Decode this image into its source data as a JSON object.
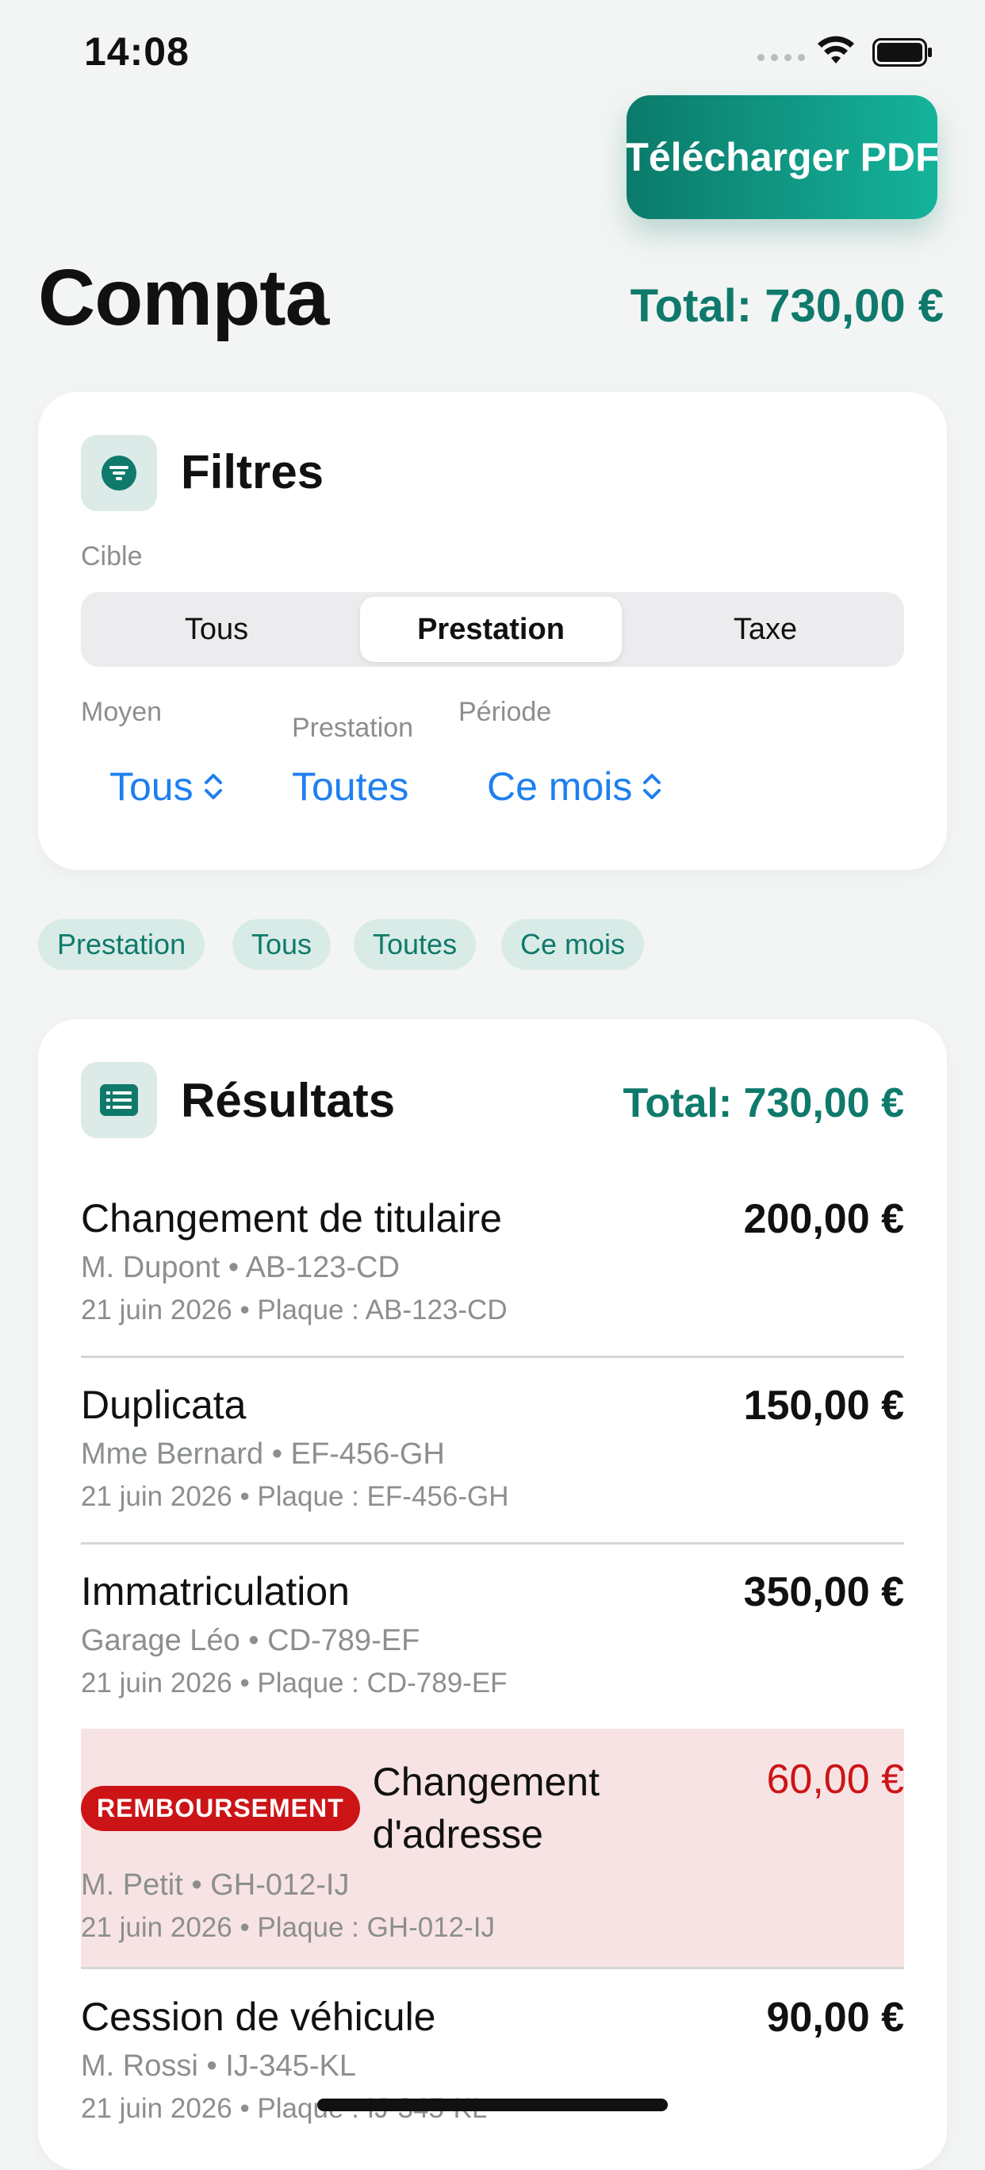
{
  "status_bar": {
    "time": "14:08"
  },
  "actions": {
    "download_pdf": "Télécharger PDF"
  },
  "header": {
    "title": "Compta",
    "total": "Total: 730,00 €"
  },
  "filters": {
    "title": "Filtres",
    "target_label": "Cible",
    "segments": [
      "Tous",
      "Prestation",
      "Taxe"
    ],
    "selected_segment": "Prestation",
    "moyen_label": "Moyen",
    "moyen_value": "Tous",
    "prestation_label": "Prestation",
    "prestation_value": "Toutes",
    "periode_label": "Période",
    "periode_value": "Ce mois"
  },
  "chips": [
    "Prestation",
    "Tous",
    "Toutes",
    "Ce mois"
  ],
  "results": {
    "title": "Résultats",
    "total": "Total: 730,00 €",
    "items": [
      {
        "title": "Changement de titulaire",
        "amount": "200,00 €",
        "client": "M. Dupont • AB-123-CD",
        "meta": "21 juin 2026   • Plaque : AB-123-CD"
      },
      {
        "title": "Duplicata",
        "amount": "150,00 €",
        "client": "Mme Bernard • EF-456-GH",
        "meta": "21 juin 2026   • Plaque : EF-456-GH"
      },
      {
        "title": "Immatriculation",
        "amount": "350,00 €",
        "client": "Garage Léo • CD-789-EF",
        "meta": "21 juin 2026   • Plaque : CD-789-EF"
      },
      {
        "badge": "REMBOURSEMENT",
        "title_line1": "Changement",
        "title_line2": "d'adresse",
        "amount": "60,00 €",
        "client": "M. Petit • GH-012-IJ",
        "meta": "21 juin 2026   • Plaque : GH-012-IJ"
      },
      {
        "title": "Cession de véhicule",
        "amount": "90,00 €",
        "client": "M. Rossi • IJ-345-KL",
        "meta": "21 juin 2026   • Plaque : IJ-345-KL"
      }
    ]
  },
  "colors": {
    "accent": "#0f7a6b",
    "link": "#1f7ff0",
    "refund": "#cc1417",
    "refund_bg": "#f8e3e4"
  }
}
